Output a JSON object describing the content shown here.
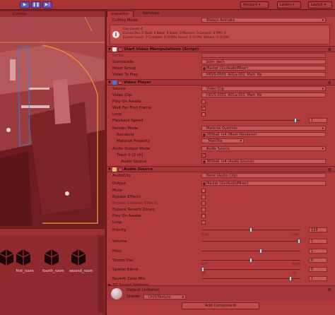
{
  "toolbar": {
    "play_icon": "play-icon",
    "pause_icon": "pause-icon",
    "step_icon": "step-icon",
    "account_label": "Account",
    "layers_label": "Layers",
    "layout_label": "Layout"
  },
  "scene": {
    "tab_label": "Console"
  },
  "project": {
    "assets": [
      {
        "label": ""
      },
      {
        "label": "first_room"
      },
      {
        "label": "fourth_room"
      },
      {
        "label": "second_room"
      }
    ]
  },
  "inspector": {
    "tabs": [
      "Inspector",
      "Services"
    ],
    "culling_mode_label": "Culling Mode",
    "culling_mode_value": "Always Animate",
    "info_lines": [
      "Clip Count: 4",
      "Curves Pos: 0 Quat: 0 Euler: 0 Scale: 0 Muscles: 0 Generic: 0 PPtr: 0",
      "Curves Count: 0 Constant: 0 (0.0%) Dense: 0 (0.0%) Stream: 0 (0.0%)"
    ],
    "script_component": {
      "title": "Start Video Manipulations (Script)",
      "fields": [
        {
          "label": "Script",
          "value": ""
        },
        {
          "label": "Scenecode",
          "value": "bdm_dach"
        },
        {
          "label": "Mixer Group",
          "value": "Master (GvrAudioMixer)"
        },
        {
          "label": "Video To Play",
          "value": "HKVS-0001_A01a-001_Main_ffp"
        }
      ]
    },
    "video_player": {
      "title": "Video Player",
      "source_label": "Source",
      "source_value": "Video Clip",
      "clip_label": "Video Clip",
      "clip_value": "HKVS-0001_A01a-001_Main_ffp",
      "play_on_awake_label": "Play On Awake",
      "wait_label": "Wait For First Frame",
      "wait_checked": "✓",
      "loop_label": "Loop",
      "speed_label": "Playback Speed",
      "speed_value": "1",
      "speed_level": 0.95,
      "render_mode_label": "Render Mode",
      "render_mode_value": "Material Override",
      "renderer_label": "Renderer",
      "renderer_value": "360ball_lv4 (Mesh Renderer)",
      "material_property_label": "Material Property",
      "material_property_value": "_MainTex",
      "audio_output_label": "Audio Output Mode",
      "audio_output_value": "Audio Source",
      "track_label": "Track 0 [2 ch]",
      "track_checked": "✓",
      "audio_source_label": "Audio Source",
      "audio_source_value": "360ball_lv4 (Audio Source)"
    },
    "audio_source": {
      "title": "Audio Source",
      "clip_label": "AudioClip",
      "clip_value": "None (Audio Clip)",
      "output_label": "Output",
      "output_value": "Master (GvrAudioMixer)",
      "mute_label": "Mute",
      "bypass_effects_label": "Bypass Effects",
      "bypass_listener_label": "Bypass Listener Effects",
      "bypass_reverb_label": "Bypass Reverb Zones",
      "play_on_awake_label": "Play On Awake",
      "loop_label": "Loop",
      "priority_label": "Priority",
      "priority_value": "128",
      "priority_level": 0.5,
      "priority_high": "High",
      "priority_low": "Low",
      "volume_label": "Volume",
      "volume_value": "1",
      "volume_level": 1.0,
      "pitch_label": "Pitch",
      "pitch_value": "1",
      "pitch_level": 0.6,
      "stereo_pan_label": "Stereo Pan",
      "stereo_pan_value": "0",
      "stereo_pan_level": 0.5,
      "stereo_left": "Left",
      "stereo_right": "Right",
      "spatial_blend_label": "Spatial Blend",
      "spatial_blend_value": "0",
      "spatial_blend_level": 0.0,
      "spatial_2d": "2D",
      "spatial_3d": "3D",
      "reverb_label": "Reverb Zone Mix",
      "reverb_value": "1",
      "reverb_level": 0.9,
      "sound_settings_label": "3D Sound Settings"
    },
    "material": {
      "name": "Default Unlitshot",
      "shader_label": "Shader",
      "shader_value": "Unlit/Texture"
    },
    "add_component_label": "Add Component"
  },
  "colors": {
    "background": "#7c1f22",
    "inspector": "#b13a3c",
    "field": "#c5595a",
    "accent_frame": "#e08a3c"
  }
}
